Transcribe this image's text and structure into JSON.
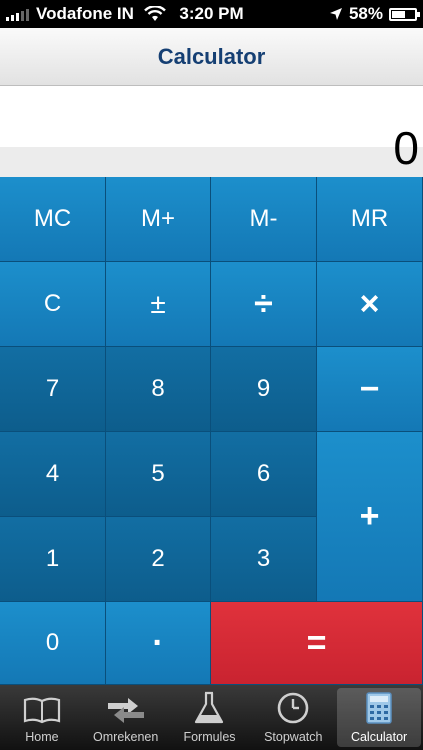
{
  "status_bar": {
    "carrier": "Vodafone IN",
    "time": "3:20 PM",
    "battery": "58%",
    "battery_level": 0.58
  },
  "navbar": {
    "title": "Calculator"
  },
  "display": {
    "value": "0"
  },
  "keys": {
    "mc": "MC",
    "mplus": "M+",
    "mminus": "M-",
    "mr": "MR",
    "clear": "C",
    "plus_minus": "±",
    "divide": "÷",
    "multiply": "×",
    "seven": "7",
    "eight": "8",
    "nine": "9",
    "minus": "−",
    "four": "4",
    "five": "5",
    "six": "6",
    "plus": "+",
    "one": "1",
    "two": "2",
    "three": "3",
    "zero": "0",
    "decimal": "·",
    "equals": "="
  },
  "tabs": [
    {
      "label": "Home",
      "icon": "book-icon"
    },
    {
      "label": "Omrekenen",
      "icon": "arrows-icon"
    },
    {
      "label": "Formules",
      "icon": "flask-icon"
    },
    {
      "label": "Stopwatch",
      "icon": "clock-icon"
    },
    {
      "label": "Calculator",
      "icon": "calculator-icon",
      "active": true
    }
  ],
  "colors": {
    "key_light": "#1680c0",
    "key_dark": "#0f6398",
    "equals": "#d72a35",
    "title": "#153f73"
  }
}
